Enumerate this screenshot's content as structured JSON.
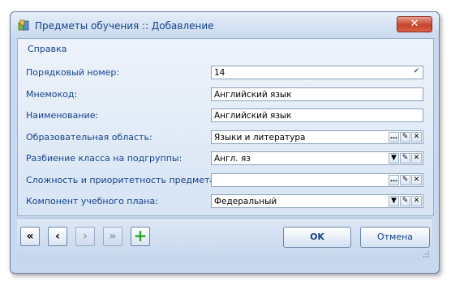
{
  "window": {
    "title": "Предметы обучения :: Добавление",
    "close_label": "✕"
  },
  "menu": {
    "help": "Справка"
  },
  "fields": [
    {
      "label": "Порядковый номер:",
      "value": "14"
    },
    {
      "label": "Мнемокод:",
      "value": "Английский язык"
    },
    {
      "label": "Наименование:",
      "value": "Английский язык"
    },
    {
      "label": "Образовательная область:",
      "value": "Языки и литература"
    },
    {
      "label": "Разбиение класса на подгруппы:",
      "value": "Англ. яз"
    },
    {
      "label": "Сложность и приоритетность предмета:",
      "value": ""
    },
    {
      "label": "Компонент учебного плана:",
      "value": "Федеральный"
    }
  ],
  "footer": {
    "first_label": "«",
    "prev_label": "‹",
    "next_label": "›",
    "last_label": "»",
    "add_label": "+",
    "ok_label": "OK",
    "cancel_label": "Отмена"
  },
  "colors": {
    "accent": "#15428b",
    "close": "#c7432c",
    "add": "#2aa52a"
  }
}
